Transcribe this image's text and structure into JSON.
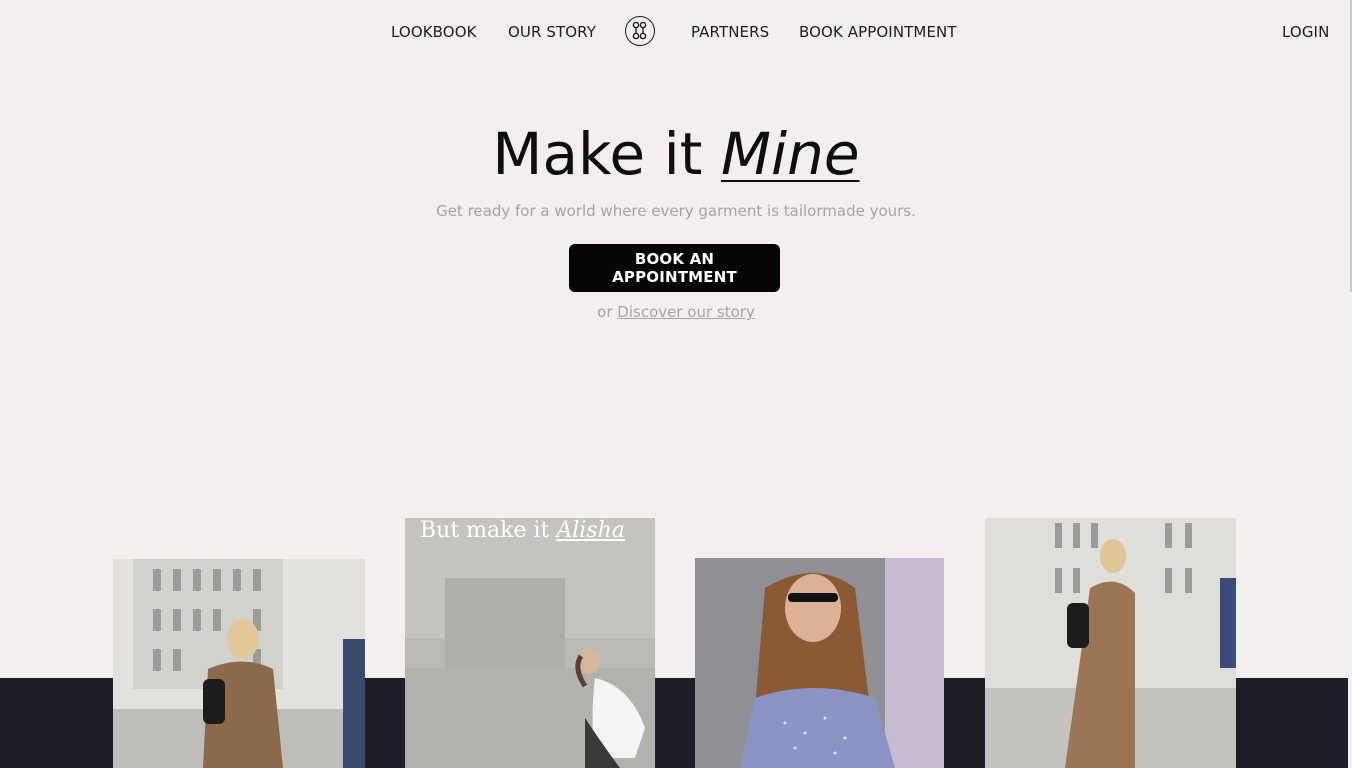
{
  "nav": {
    "links": [
      "LOOKBOOK",
      "OUR STORY",
      "PARTNERS",
      "BOOK APPOINTMENT"
    ],
    "login": "LOGIN",
    "logo_icon": "buttons-logo-icon"
  },
  "hero": {
    "title_main": "Make it",
    "title_emph": "Mine",
    "subtitle": "Get ready for a world where every garment is tailormade yours.",
    "cta_label": "BOOK AN APPOINTMENT",
    "alt_prefix": "or",
    "alt_link": "Discover our story"
  },
  "gallery": {
    "photo2_overlay_main": "But make it",
    "photo2_overlay_script": "Alisha"
  },
  "colors": {
    "background": "#f4eeee",
    "band": "#1f1d28",
    "cta": "#050505",
    "muted_text": "#a8a4a4"
  }
}
